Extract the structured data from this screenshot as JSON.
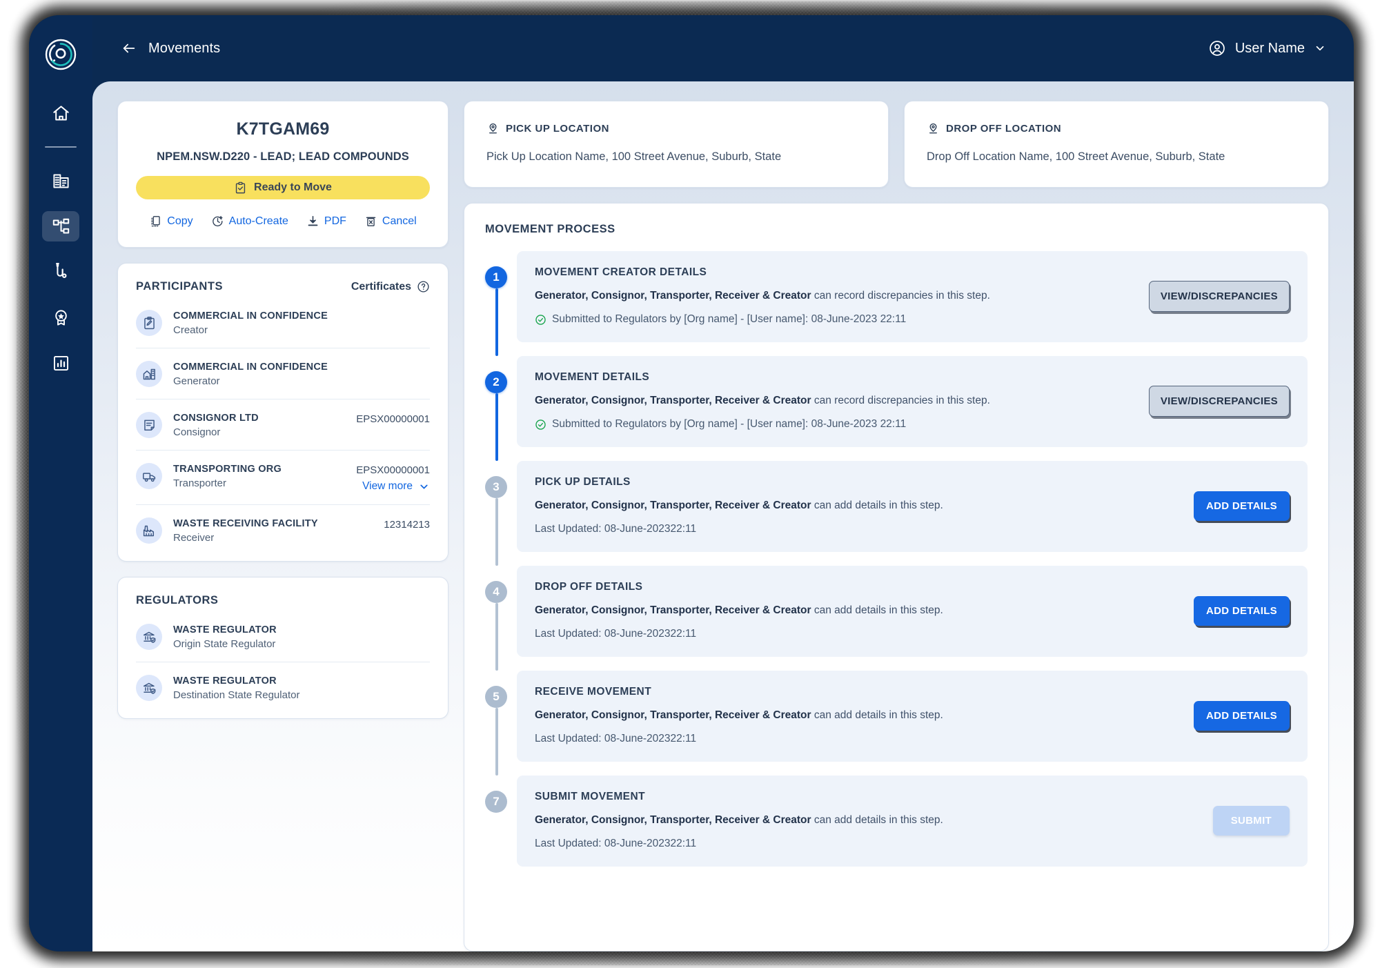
{
  "topbar": {
    "back_label": "Movements",
    "user_name": "User Name"
  },
  "sidebar": {
    "logo_name": "app-logo",
    "items": [
      {
        "name": "home",
        "icon": "home-icon",
        "active": false
      },
      {
        "name": "organisations",
        "icon": "building-icon",
        "active": false
      },
      {
        "name": "movements",
        "icon": "sitemap-icon",
        "active": true
      },
      {
        "name": "routes",
        "icon": "route-icon",
        "active": false
      },
      {
        "name": "certificates",
        "icon": "award-icon",
        "active": false
      },
      {
        "name": "reports",
        "icon": "chart-icon",
        "active": false
      }
    ]
  },
  "summary": {
    "code": "K7TGAM69",
    "waste_code": "NPEM.NSW.D220 - LEAD; LEAD COMPOUNDS",
    "status": "Ready to Move",
    "status_icon": "clipboard-check-icon",
    "status_color": "#f8e05e",
    "actions": [
      {
        "label": "Copy",
        "icon": "copy-icon"
      },
      {
        "label": "Auto-Create",
        "icon": "clock-plus-icon"
      },
      {
        "label": "PDF",
        "icon": "download-icon"
      },
      {
        "label": "Cancel",
        "icon": "trash-icon"
      }
    ]
  },
  "participants": {
    "title": "PARTICIPANTS",
    "certificates_label": "Certificates",
    "help_icon": "question-circle-icon",
    "view_more_label": "View more",
    "rows": [
      {
        "name": "COMMERCIAL IN CONFIDENCE",
        "role": "Creator",
        "cert": "",
        "icon": "clipboard-pencil-icon",
        "view_more": false
      },
      {
        "name": "COMMERCIAL IN CONFIDENCE",
        "role": "Generator",
        "cert": "",
        "icon": "factory-home-icon",
        "view_more": false
      },
      {
        "name": "CONSIGNOR LTD",
        "role": "Consignor",
        "cert": "EPSX00000001",
        "icon": "document-icon",
        "view_more": false
      },
      {
        "name": "TRANSPORTING ORG",
        "role": "Transporter",
        "cert": "EPSX00000001",
        "icon": "truck-icon",
        "view_more": true
      },
      {
        "name": "WASTE RECEIVING FACILITY",
        "role": "Receiver",
        "cert": "12314213",
        "icon": "factory-icon",
        "view_more": false
      }
    ]
  },
  "regulators": {
    "title": "REGULATORS",
    "rows": [
      {
        "name": "WASTE REGULATOR",
        "role": "Origin State Regulator",
        "icon": "bank-shield-icon"
      },
      {
        "name": "WASTE REGULATOR",
        "role": "Destination State Regulator",
        "icon": "bank-shield-icon"
      }
    ]
  },
  "locations": [
    {
      "title": "PICK UP LOCATION",
      "icon": "map-pin-icon",
      "address": "Pick Up Location Name, 100 Street Avenue, Suburb, State"
    },
    {
      "title": "DROP OFF LOCATION",
      "icon": "map-pin-icon",
      "address": "Drop Off Location Name, 100 Street Avenue, Suburb, State"
    }
  ],
  "process": {
    "title": "MOVEMENT PROCESS",
    "steps": [
      {
        "number": "1",
        "title": "MOVEMENT CREATOR DETAILS",
        "desc_bold": "Generator, Consignor, Transporter, Receiver & Creator",
        "desc_rest": " can record discrepancies in this step.",
        "meta": "Submitted to Regulators by [Org name] - [User name]: 08-June-2023 22:11",
        "meta_icon": "check-circle-icon",
        "state": "done",
        "button": {
          "label": "VIEW/DISCREPANCIES",
          "style": "ghost"
        }
      },
      {
        "number": "2",
        "title": "MOVEMENT DETAILS",
        "desc_bold": "Generator, Consignor, Transporter, Receiver & Creator",
        "desc_rest": " can record discrepancies in this step.",
        "meta": "Submitted to Regulators by [Org name] - [User name]: 08-June-2023 22:11",
        "meta_icon": "check-circle-icon",
        "state": "done",
        "button": {
          "label": "VIEW/DISCREPANCIES",
          "style": "ghost"
        }
      },
      {
        "number": "3",
        "title": "PICK UP DETAILS",
        "desc_bold": "Generator, Consignor, Transporter, Receiver & Creator",
        "desc_rest": " can add details  in this step.",
        "meta": "Last Updated: 08-June-202322:11",
        "meta_icon": "",
        "state": "todo",
        "button": {
          "label": "ADD DETAILS",
          "style": "primary"
        }
      },
      {
        "number": "4",
        "title": "DROP OFF DETAILS",
        "desc_bold": "Generator, Consignor, Transporter, Receiver & Creator",
        "desc_rest": " can add details  in this step.",
        "meta": "Last Updated: 08-June-202322:11",
        "meta_icon": "",
        "state": "todo",
        "button": {
          "label": "ADD DETAILS",
          "style": "primary"
        }
      },
      {
        "number": "5",
        "title": "RECEIVE MOVEMENT",
        "desc_bold": "Generator, Consignor, Transporter, Receiver & Creator",
        "desc_rest": " can add details  in this step.",
        "meta": "Last Updated: 08-June-202322:11",
        "meta_icon": "",
        "state": "todo",
        "button": {
          "label": "ADD DETAILS",
          "style": "primary"
        }
      },
      {
        "number": "7",
        "title": "SUBMIT MOVEMENT",
        "desc_bold": "Generator, Consignor, Transporter, Receiver & Creator",
        "desc_rest": " can add details  in this step.",
        "meta": "Last Updated: 08-June-202322:11",
        "meta_icon": "",
        "state": "todo",
        "button": {
          "label": "SUBMIT",
          "style": "disabled"
        }
      }
    ]
  },
  "colors": {
    "sidebar": "#0a2a55",
    "accent_blue": "#1266e0",
    "status_yellow": "#f8e05e",
    "step_done": "#1266e0",
    "step_todo": "#acbccf",
    "text_dark": "#2c3e56"
  }
}
